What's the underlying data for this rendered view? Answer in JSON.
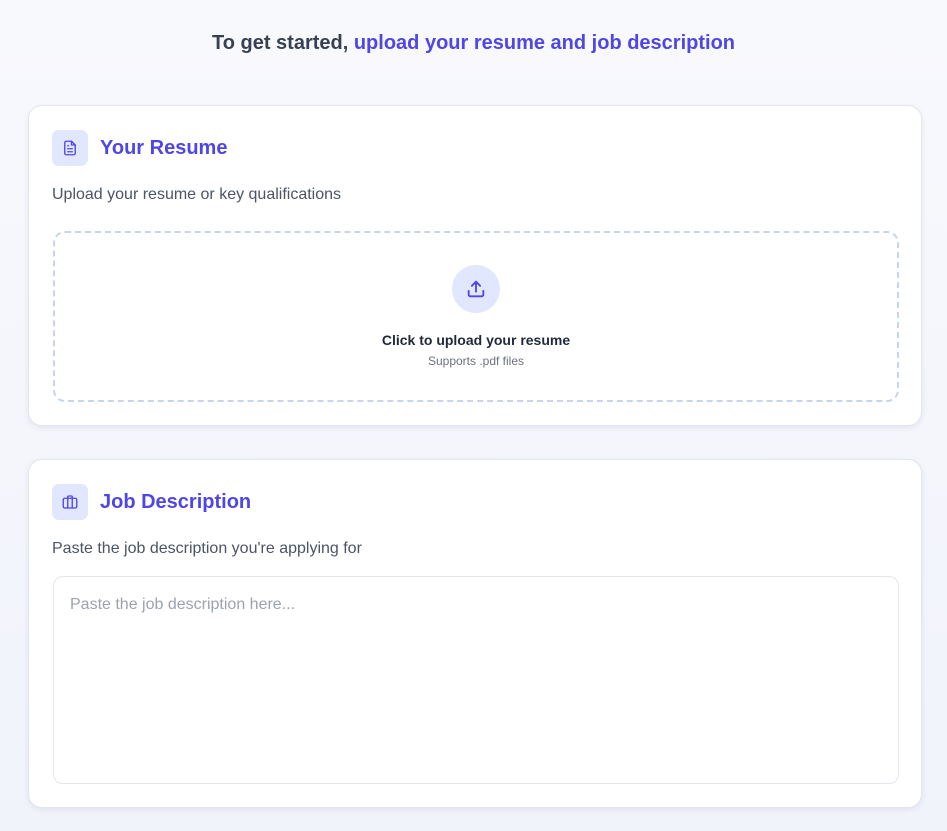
{
  "headline": {
    "prefix": "To get started,",
    "accent": "upload your resume and job description"
  },
  "resume_card": {
    "icon": "document-icon",
    "title": "Your Resume",
    "subtitle": "Upload your resume or key qualifications",
    "dropzone": {
      "icon": "upload-icon",
      "title": "Click to upload your resume",
      "hint": "Supports .pdf files"
    }
  },
  "job_card": {
    "icon": "briefcase-icon",
    "title": "Job Description",
    "subtitle": "Paste the job description you're applying for",
    "textarea": {
      "value": "",
      "placeholder": "Paste the job description here..."
    }
  },
  "colors": {
    "accent": "#4f46e5",
    "icon_bg": "#e0e7ff",
    "dropzone_border": "#c7d4ee",
    "page_bg": "#f4f6fc"
  }
}
